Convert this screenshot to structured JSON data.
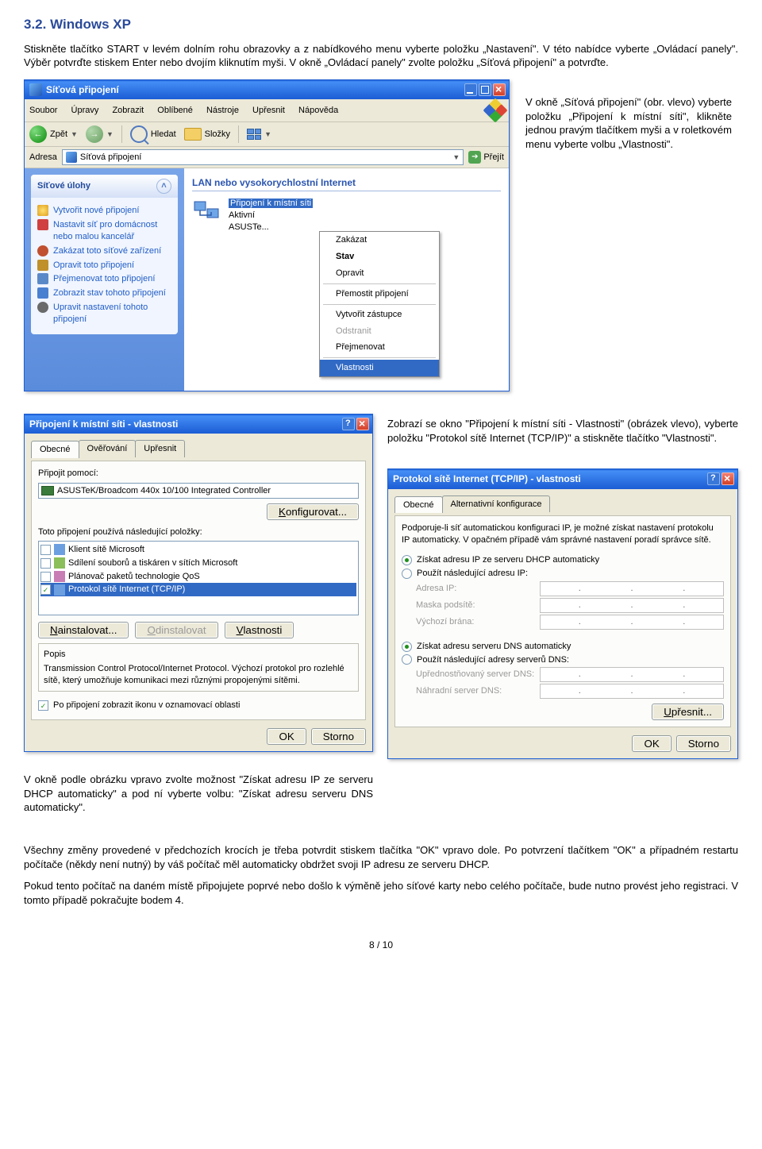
{
  "section": {
    "title": "3.2. Windows XP",
    "intro": "Stiskněte tlačítko START v levém dolním rohu obrazovky a z nabídkového menu vyberte položku „Nastavení\". V této nabídce vyberte „Ovládací panely\". Výběr potvrďte stiskem Enter nebo dvojím kliknutím myši. V okně „Ovládací panely\" zvolte položku „Síťová  připojení\" a potvrďte."
  },
  "aside1": "V okně „Síťová připojení\" (obr. vlevo) vyberte položku „Připojení k místní síti\", klikněte jednou pravým tlačítkem myši a v roletkovém menu vyberte volbu „Vlastnosti\".",
  "xp_explorer": {
    "title": "Síťová připojení",
    "menubar": [
      "Soubor",
      "Úpravy",
      "Zobrazit",
      "Oblíbené",
      "Nástroje",
      "Upřesnit",
      "Nápověda"
    ],
    "toolbar": {
      "back": "Zpět",
      "search": "Hledat",
      "folders": "Složky"
    },
    "addressbar": {
      "label": "Adresa",
      "value": "Síťová připojení",
      "go": "Přejít"
    },
    "tasks_header": "Síťové úlohy",
    "tasks": [
      "Vytvořit nové připojení",
      "Nastavit síť pro domácnost nebo malou kancelář",
      "Zakázat toto síťové zařízení",
      "Opravit toto připojení",
      "Přejmenovat toto připojení",
      "Zobrazit stav tohoto připojení",
      "Upravit nastavení tohoto připojení"
    ],
    "group_header": "LAN nebo vysokorychlostní Internet",
    "connection": {
      "name": "Připojení k místní síti",
      "status": "Aktivní",
      "device": "ASUSTe..."
    },
    "ctx_menu": {
      "disable": "Zakázat",
      "status": "Stav",
      "repair": "Opravit",
      "bridge": "Přemostit připojení",
      "shortcut": "Vytvořit zástupce",
      "delete": "Odstranit",
      "rename": "Přejmenovat",
      "properties": "Vlastnosti"
    }
  },
  "aside2": "Zobrazí se okno \"Připojení k místní síti - Vlastnosti\" (obrázek vlevo), vyberte  položku \"Protokol sítě Internet (TCP/IP)\"  a stiskněte tlačítko \"Vlastnosti\".",
  "dialog1": {
    "title": "Připojení k místní síti - vlastnosti",
    "tabs": [
      "Obecné",
      "Ověřování",
      "Upřesnit"
    ],
    "connect_using": "Připojit pomocí:",
    "adapter": "ASUSTeK/Broadcom 440x 10/100 Integrated Controller",
    "configure": "Konfigurovat...",
    "uses_label": "Toto připojení používá následující položky:",
    "items": [
      {
        "checked": false,
        "label": "Klient sítě Microsoft"
      },
      {
        "checked": false,
        "label": "Sdílení souborů a tiskáren v sítích Microsoft"
      },
      {
        "checked": false,
        "label": "Plánovač paketů technologie QoS"
      },
      {
        "checked": true,
        "label": "Protokol sítě Internet (TCP/IP)",
        "selected": true
      }
    ],
    "install": "Nainstalovat...",
    "uninstall": "Odinstalovat",
    "properties": "Vlastnosti",
    "desc_title": "Popis",
    "desc": "Transmission Control Protocol/Internet Protocol. Výchozí protokol pro rozlehlé sítě, který umožňuje komunikaci mezi různými propojenými sítěmi.",
    "notify": "Po připojení zobrazit ikonu v oznamovací oblasti",
    "ok": "OK",
    "cancel": "Storno"
  },
  "dialog2": {
    "title": "Protokol sítě Internet (TCP/IP) - vlastnosti",
    "tabs": [
      "Obecné",
      "Alternativní konfigurace"
    ],
    "desc": "Podporuje-li síť automatickou konfiguraci IP, je možné získat nastavení protokolu IP automaticky. V opačném případě vám správné nastavení poradí správce sítě.",
    "radio_auto_ip": "Získat adresu IP ze serveru DHCP automaticky",
    "radio_manual_ip": "Použít následující adresu IP:",
    "ip": "Adresa IP:",
    "mask": "Maska podsítě:",
    "gateway": "Výchozí brána:",
    "radio_auto_dns": "Získat adresu serveru DNS automaticky",
    "radio_manual_dns": "Použít následující adresy serverů DNS:",
    "dns1": "Upřednostňovaný server DNS:",
    "dns2": "Náhradní server DNS:",
    "advanced": "Upřesnit...",
    "ok": "OK",
    "cancel": "Storno"
  },
  "aside3": "V okně podle obrázku vpravo zvolte možnost \"Získat adresu IP ze serveru DHCP automaticky\" a pod ní vyberte volbu: \"Získat adresu serveru DNS automaticky\".",
  "closing_p1": "Všechny změny provedené v předchozích krocích je třeba potvrdit stiskem tlačítka \"OK\" vpravo dole. Po potvrzení tlačítkem \"OK\" a případném restartu počítače (někdy není nutný) by váš počítač měl automaticky obdržet svoji IP adresu ze serveru DHCP.",
  "closing_p2": "Pokud tento počítač na daném místě připojujete poprvé nebo došlo k výměně jeho síťové karty nebo celého počítače, bude nutno provést jeho registraci. V tomto případě pokračujte bodem 4.",
  "page_num": "8 / 10"
}
